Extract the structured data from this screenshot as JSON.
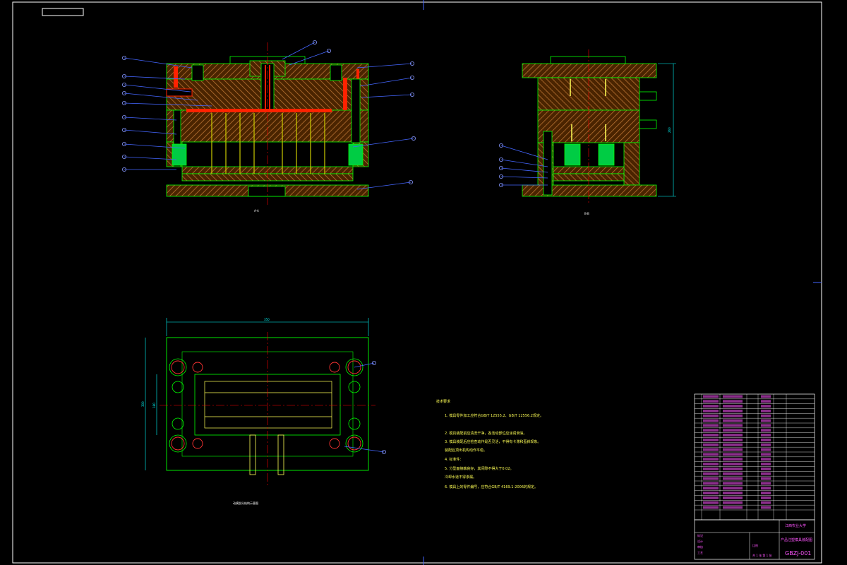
{
  "drawing": {
    "code": "GBZJ-001",
    "part_name": "产品注塑模具装配图",
    "university": "江西农业大学",
    "front_section_label": "A-A",
    "side_section_label": "B-B",
    "plan_title": "动模部分结构示意图",
    "plan_width_dim": "350",
    "plan_height_dim": "300",
    "plan_inner_dim": "180",
    "side_height_dim": "260"
  },
  "notes": {
    "heading": "技术要求",
    "lines": [
      "1. 模具零件加工应符合GB/T 12555.2、GB/T 12556.2规定。",
      "2. 模具装配前应清洗干净，各活动部位应涂润滑油。",
      "3. 模具装配后应检查动作是否灵活，不得有卡滞和歪斜现象。",
      "   装配后顶出机构动作平稳。",
      "4. 标准件：",
      "5. 分型面接触良好，其间隙不得大于0.02。",
      "   冷却水道不得渗漏。",
      "6. 模具上的零件编号，应符合GB/T 4169.1-2006的规定。"
    ]
  },
  "title_block": {
    "left_rows": [
      "标记",
      "设计",
      "审核",
      "工艺"
    ],
    "scale_label": "比例",
    "sheet_label": "共 1 张 第 1 张"
  },
  "colors": {
    "outline": "#ffffff",
    "steel": "#cc6633",
    "hatch": "#b87333",
    "line_green": "#00ff00",
    "cavity_red": "#ff2200",
    "insert_green": "#00cc44",
    "leader_blue": "#4466ff",
    "center_red": "#ff0000",
    "text_pink": "#ff55ff",
    "text_yellow": "#ffff55"
  }
}
